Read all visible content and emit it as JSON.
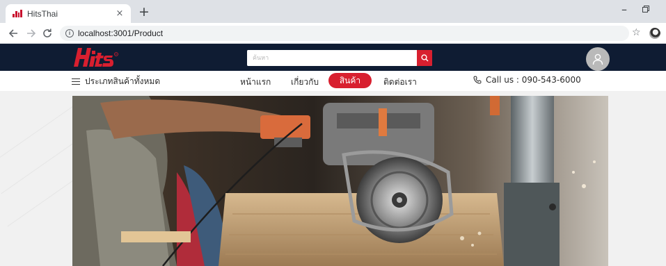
{
  "browser": {
    "tab_title": "HitsThai",
    "tab_close": "×",
    "new_tab": "+",
    "url": "localhost:3001/Product"
  },
  "header": {
    "logo_text": "Hits",
    "search_placeholder": "ค้นหา",
    "brand_color": "#d81f2f",
    "header_bg": "#0f1c33"
  },
  "nav": {
    "categories": "ประเภทสินค้าทั้งหมด",
    "links": [
      {
        "label": "หน้าแรก"
      },
      {
        "label": "เกี่ยวกับ"
      },
      {
        "label": "สินค้า"
      },
      {
        "label": "ติดต่อเรา"
      }
    ],
    "call": "Call us : 090-543-6000"
  },
  "icons": {
    "back": "arrow-left-icon",
    "forward": "arrow-right-icon",
    "reload": "reload-icon",
    "info": "info-icon",
    "star": "bookmark-star-icon",
    "search": "search-icon",
    "user": "user-icon",
    "phone": "phone-icon",
    "menu": "hamburger-menu-icon"
  }
}
